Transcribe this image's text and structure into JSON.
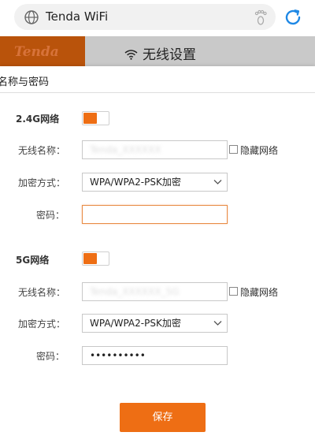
{
  "browser": {
    "url_text": "Tenda WiFi",
    "icons": {
      "site": "globe-icon",
      "extension": "footprint-icon",
      "reload": "reload-icon"
    }
  },
  "header": {
    "logo": "Tenda",
    "wifi_icon": "wifi-icon",
    "title": "无线设置"
  },
  "panel": {
    "title": "名称与密码",
    "band_24": {
      "label": "2.4G网络",
      "enabled": true,
      "ssid_label": "无线名称：",
      "ssid_value": "Tenda_XXXXXX",
      "hide_label": "隐藏网络",
      "security_label": "加密方式：",
      "security_value": "WPA/WPA2-PSK加密",
      "password_label": "密码：",
      "password_value": ""
    },
    "band_5": {
      "label": "5G网络",
      "enabled": true,
      "ssid_label": "无线名称：",
      "ssid_value": "Tenda_XXXXXX_5G",
      "hide_label": "隐藏网络",
      "security_label": "加密方式：",
      "security_value": "WPA/WPA2-PSK加密",
      "password_label": "密码：",
      "password_value": "••••••••••"
    },
    "save_label": "保存"
  },
  "colors": {
    "accent": "#ee6e14",
    "logo_bg": "#b9530b",
    "header_bg": "#c9c9c9",
    "reload": "#1e88e5"
  }
}
